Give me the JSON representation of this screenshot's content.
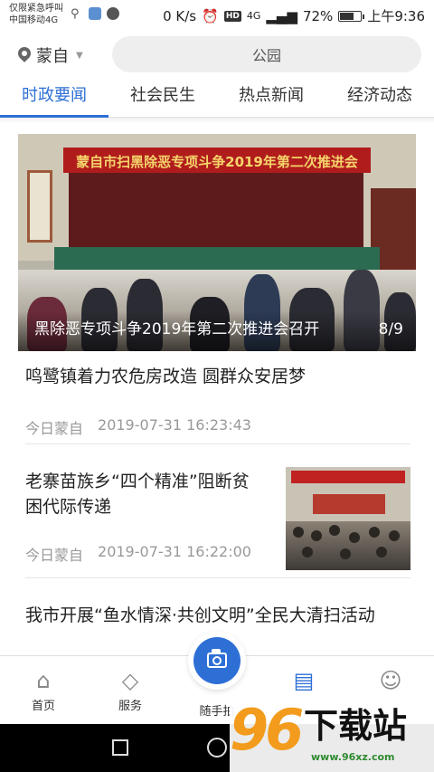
{
  "status_bar": {
    "line1": "仅限紧急呼叫",
    "line2": "中国移动4G",
    "speed": "0 K/s",
    "hd": "HD",
    "net": "4G",
    "battery": "72%",
    "battery_level": 0.72,
    "time": "上午9:36"
  },
  "header": {
    "location": "蒙自",
    "search_placeholder": "公园"
  },
  "tabs": [
    {
      "label": "时政要闻",
      "active": true
    },
    {
      "label": "社会民生",
      "active": false
    },
    {
      "label": "热点新闻",
      "active": false
    },
    {
      "label": "经济动态",
      "active": false
    }
  ],
  "banner": {
    "meeting_banner_text": "蒙自市扫黑除恶专项斗争2019年第二次推进会",
    "caption": "黑除恶专项斗争2019年第二次推进会召开",
    "counter": "8/9"
  },
  "news": [
    {
      "title": "鸣鹭镇着力农危房改造 圆群众安居梦",
      "source": "今日蒙自",
      "time": "2019-07-31 16:23:43"
    },
    {
      "title_line1": "老寨苗族乡“四个精准”阻断贫",
      "title_line2": "困代际传递",
      "source": "今日蒙自",
      "time": "2019-07-31 16:22:00"
    },
    {
      "title": "我市开展“鱼水情深·共创文明”全民大清扫活动"
    }
  ],
  "bottom_nav": [
    {
      "label": "首页",
      "icon": "home-icon",
      "active": false
    },
    {
      "label": "服务",
      "icon": "service-icon",
      "active": false
    },
    {
      "label": "随手拍",
      "icon": "camera-icon",
      "active": false
    },
    {
      "label": "",
      "icon": "document-icon",
      "active": true
    },
    {
      "label": "",
      "icon": "user-icon",
      "active": false
    }
  ],
  "watermark": {
    "number": "96",
    "text": "下载站",
    "url": "www.96xz.com"
  },
  "colors": {
    "accent": "#2e6fd6",
    "watermark_orange": "#f29b1c"
  }
}
